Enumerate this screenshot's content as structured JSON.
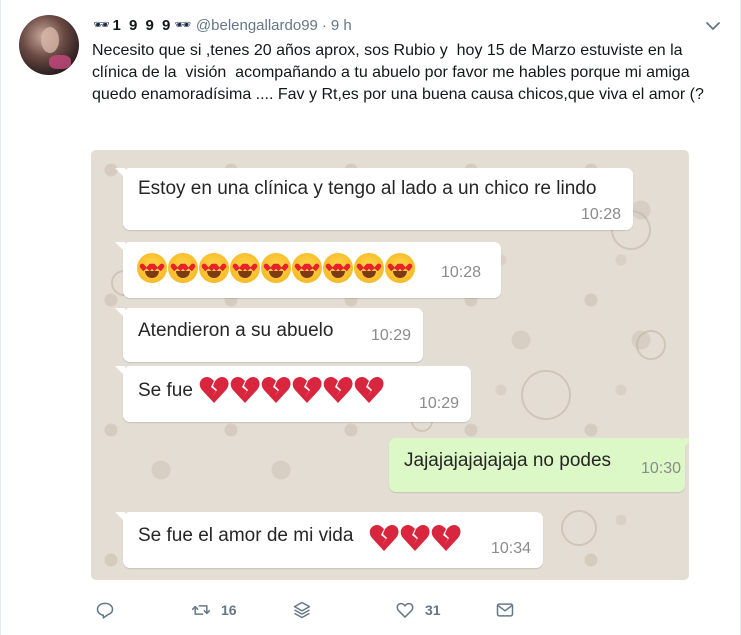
{
  "tweet": {
    "display_name": "1 9 9 9",
    "display_name_decoration": "sunglasses-emoji",
    "handle": "@belengallardo99",
    "separator": "·",
    "timestamp": "9 h",
    "text": "Necesito que si ,tenes 20 años aprox, sos Rubio y  hoy 15 de Marzo estuviste en la clínica de la  visión  acompañando a tu abuelo por favor me hables porque mi amiga quedo enamoradísima .... Fav y Rt,es por una buena causa chicos,que viva el amor (?"
  },
  "chat": {
    "messages": [
      {
        "direction": "in",
        "text": "Estoy en una clínica y tengo al lado a un chico re lindo",
        "time": "10:28"
      },
      {
        "direction": "in",
        "emoji": "smiling-face-with-heart-eyes",
        "emoji_count": 9,
        "time": "10:28"
      },
      {
        "direction": "in",
        "text": "Atendieron a su abuelo",
        "time": "10:29"
      },
      {
        "direction": "in",
        "text": "Se fue",
        "emoji": "broken-heart",
        "emoji_count": 6,
        "time": "10:29"
      },
      {
        "direction": "out",
        "text": "Jajajajajajajaja no podes",
        "time": "10:30"
      },
      {
        "direction": "in",
        "text": "Se fue el amor de mi vida",
        "emoji": "broken-heart",
        "emoji_count": 3,
        "time": "10:34"
      }
    ],
    "colors": {
      "incoming": "#ffffff",
      "outgoing": "#dcf8c6",
      "wallpaper": "#e4ddd3"
    }
  },
  "actions": {
    "reply_icon": "reply-icon",
    "retweet_icon": "retweet-icon",
    "retweet_count": "16",
    "stack_icon": "layers-icon",
    "like_icon": "heart-outline-icon",
    "like_count": "31",
    "dm_icon": "envelope-icon"
  },
  "colors": {
    "text": "#14171a",
    "muted": "#657786",
    "link_blue": "#1da1f2"
  }
}
